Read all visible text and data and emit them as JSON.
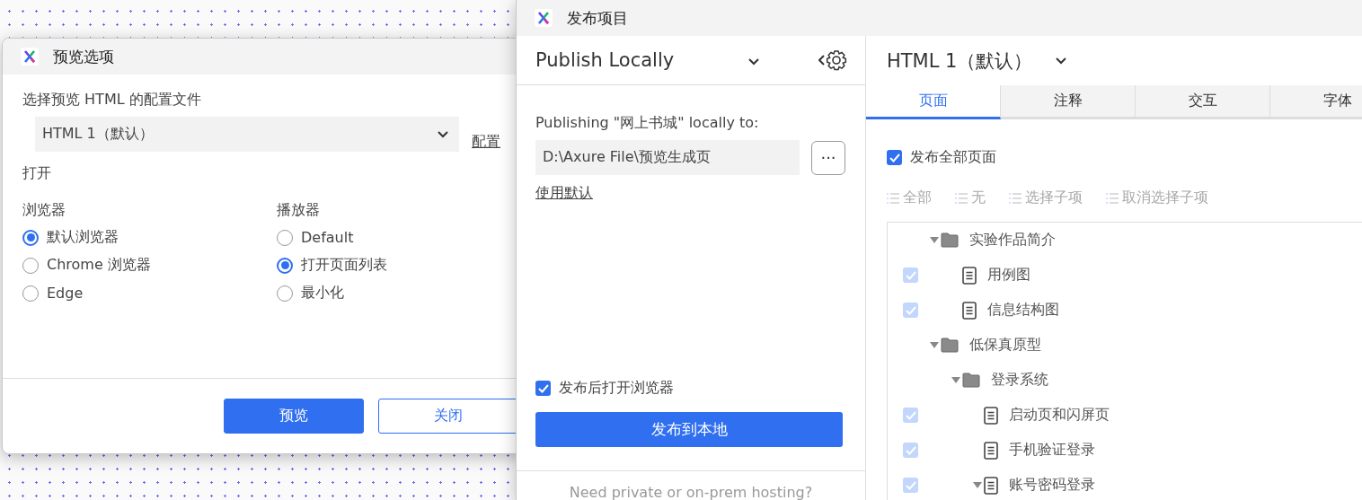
{
  "preview_dialog": {
    "title": "预览选项",
    "profile_label": "选择预览 HTML 的配置文件",
    "profile_value": "HTML 1（默认）",
    "configure_link": "配置",
    "open_label": "打开",
    "groups": [
      {
        "title": "浏览器",
        "options": [
          {
            "label": "默认浏览器",
            "selected": true
          },
          {
            "label": "Chrome 浏览器",
            "selected": false
          },
          {
            "label": "Edge",
            "selected": false
          }
        ]
      },
      {
        "title": "播放器",
        "options": [
          {
            "label": "Default",
            "selected": false
          },
          {
            "label": "打开页面列表",
            "selected": true
          },
          {
            "label": "最小化",
            "selected": false
          }
        ]
      }
    ],
    "buttons": [
      {
        "label": "预览",
        "kind": "primary"
      },
      {
        "label": "关闭",
        "kind": "secondary"
      }
    ]
  },
  "publish_window": {
    "title": "发布项目",
    "left_panel": {
      "method": "Publish Locally",
      "target_label": "Publishing \"网上书城\" locally to:",
      "path": "D:\\Axure File\\预览生成页",
      "browse_button": "···",
      "use_default_link": "使用默认",
      "open_after": {
        "label": "发布后打开浏览器",
        "checked": true
      },
      "publish_button": "发布到本地",
      "hosting_note": "Need private or on-prem hosting?"
    },
    "right_panel": {
      "profile": "HTML 1（默认）",
      "tabs": [
        {
          "label": "页面",
          "selected": true
        },
        {
          "label": "注释",
          "selected": false
        },
        {
          "label": "交互",
          "selected": false
        },
        {
          "label": "字体",
          "selected": false
        }
      ],
      "publish_all": {
        "label": "发布全部页面",
        "checked": true
      },
      "tools": [
        {
          "label": "全部",
          "disabled": true
        },
        {
          "label": "无",
          "disabled": true
        },
        {
          "label": "选择子项",
          "disabled": true
        },
        {
          "label": "取消选择子项",
          "disabled": true
        }
      ],
      "tree": {
        "disabled": true,
        "items": [
          {
            "kind": "folder",
            "label": "实验作品简介",
            "expanded": true,
            "children": [
              {
                "kind": "page",
                "label": "用例图",
                "checked": true
              },
              {
                "kind": "page",
                "label": "信息结构图",
                "checked": true
              }
            ]
          },
          {
            "kind": "folder",
            "label": "低保真原型",
            "expanded": true,
            "children": [
              {
                "kind": "folder",
                "label": "登录系统",
                "expanded": true,
                "children": [
                  {
                    "kind": "page",
                    "label": "启动页和闪屏页",
                    "checked": true
                  },
                  {
                    "kind": "page",
                    "label": "手机验证登录",
                    "checked": true
                  },
                  {
                    "kind": "page",
                    "label": "账号密码登录",
                    "checked": true,
                    "expanded": true
                  }
                ]
              }
            ]
          }
        ]
      }
    }
  }
}
